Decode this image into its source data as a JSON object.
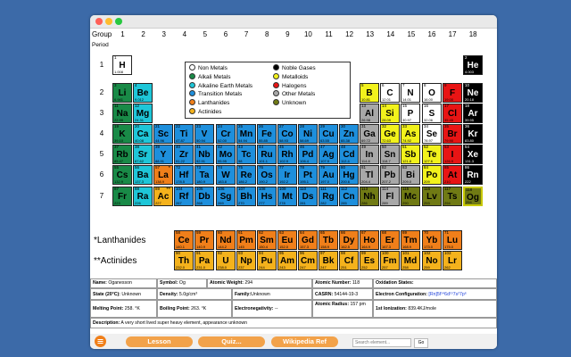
{
  "header": {
    "group_label": "Group",
    "period_label": "Period",
    "groups": [
      "1",
      "2",
      "3",
      "4",
      "5",
      "6",
      "7",
      "8",
      "9",
      "10",
      "11",
      "12",
      "13",
      "14",
      "15",
      "16",
      "17",
      "18"
    ],
    "periods": [
      "1",
      "2",
      "3",
      "4",
      "5",
      "6",
      "7"
    ]
  },
  "legend": [
    {
      "label": "Non Metals",
      "color": "#ffffff"
    },
    {
      "label": "Alkali Metals",
      "color": "#198a47"
    },
    {
      "label": "Alkaline Earth Metals",
      "color": "#1ec6d8"
    },
    {
      "label": "Transition Metals",
      "color": "#1e8fdc"
    },
    {
      "label": "Lanthanides",
      "color": "#f07f1a"
    },
    {
      "label": "Actinides",
      "color": "#f4b21c"
    },
    {
      "label": "Noble Gases",
      "color": "#000000"
    },
    {
      "label": "Metalloids",
      "color": "#f2f21c"
    },
    {
      "label": "Halogens",
      "color": "#e81414"
    },
    {
      "label": "Other Metals",
      "color": "#a8a8a8"
    },
    {
      "label": "Unknown",
      "color": "#707a14"
    }
  ],
  "colors": {
    "N": "#ffffff",
    "A": "#198a47",
    "E": "#1ec6d8",
    "T": "#1e8fdc",
    "L": "#f07f1a",
    "C": "#f4b21c",
    "G": "#000000",
    "M": "#f2f21c",
    "H": "#e81414",
    "O": "#a8a8a8",
    "U": "#707a14"
  },
  "elements": [
    {
      "n": "1",
      "s": "H",
      "w": "1.008",
      "g": 1,
      "p": 1,
      "c": "N"
    },
    {
      "n": "2",
      "s": "He",
      "w": "4.003",
      "g": 18,
      "p": 1,
      "c": "G"
    },
    {
      "n": "3",
      "s": "Li",
      "w": "6.941",
      "g": 1,
      "p": 2,
      "c": "A"
    },
    {
      "n": "4",
      "s": "Be",
      "w": "9.012",
      "g": 2,
      "p": 2,
      "c": "E"
    },
    {
      "n": "5",
      "s": "B",
      "w": "10.81",
      "g": 13,
      "p": 2,
      "c": "M"
    },
    {
      "n": "6",
      "s": "C",
      "w": "12.01",
      "g": 14,
      "p": 2,
      "c": "N"
    },
    {
      "n": "7",
      "s": "N",
      "w": "14.01",
      "g": 15,
      "p": 2,
      "c": "N"
    },
    {
      "n": "8",
      "s": "O",
      "w": "16.00",
      "g": 16,
      "p": 2,
      "c": "N"
    },
    {
      "n": "9",
      "s": "F",
      "w": "19.00",
      "g": 17,
      "p": 2,
      "c": "H"
    },
    {
      "n": "10",
      "s": "Ne",
      "w": "20.18",
      "g": 18,
      "p": 2,
      "c": "G"
    },
    {
      "n": "11",
      "s": "Na",
      "w": "22.99",
      "g": 1,
      "p": 3,
      "c": "A"
    },
    {
      "n": "12",
      "s": "Mg",
      "w": "24.31",
      "g": 2,
      "p": 3,
      "c": "E"
    },
    {
      "n": "13",
      "s": "Al",
      "w": "26.98",
      "g": 13,
      "p": 3,
      "c": "O"
    },
    {
      "n": "14",
      "s": "Si",
      "w": "28.09",
      "g": 14,
      "p": 3,
      "c": "M"
    },
    {
      "n": "15",
      "s": "P",
      "w": "30.97",
      "g": 15,
      "p": 3,
      "c": "N"
    },
    {
      "n": "16",
      "s": "S",
      "w": "32.06",
      "g": 16,
      "p": 3,
      "c": "N"
    },
    {
      "n": "17",
      "s": "Cl",
      "w": "35.45",
      "g": 17,
      "p": 3,
      "c": "H"
    },
    {
      "n": "18",
      "s": "Ar",
      "w": "39.95",
      "g": 18,
      "p": 3,
      "c": "G"
    },
    {
      "n": "19",
      "s": "K",
      "w": "39.10",
      "g": 1,
      "p": 4,
      "c": "A"
    },
    {
      "n": "20",
      "s": "Ca",
      "w": "40.08",
      "g": 2,
      "p": 4,
      "c": "E"
    },
    {
      "n": "21",
      "s": "Sc",
      "w": "44.96",
      "g": 3,
      "p": 4,
      "c": "T"
    },
    {
      "n": "22",
      "s": "Ti",
      "w": "47.87",
      "g": 4,
      "p": 4,
      "c": "T"
    },
    {
      "n": "23",
      "s": "V",
      "w": "50.94",
      "g": 5,
      "p": 4,
      "c": "T"
    },
    {
      "n": "24",
      "s": "Cr",
      "w": "52.00",
      "g": 6,
      "p": 4,
      "c": "T"
    },
    {
      "n": "25",
      "s": "Mn",
      "w": "54.94",
      "g": 7,
      "p": 4,
      "c": "T"
    },
    {
      "n": "26",
      "s": "Fe",
      "w": "55.85",
      "g": 8,
      "p": 4,
      "c": "T"
    },
    {
      "n": "27",
      "s": "Co",
      "w": "58.93",
      "g": 9,
      "p": 4,
      "c": "T"
    },
    {
      "n": "28",
      "s": "Ni",
      "w": "58.69",
      "g": 10,
      "p": 4,
      "c": "T"
    },
    {
      "n": "29",
      "s": "Cu",
      "w": "63.55",
      "g": 11,
      "p": 4,
      "c": "T"
    },
    {
      "n": "30",
      "s": "Zn",
      "w": "65.38",
      "g": 12,
      "p": 4,
      "c": "T"
    },
    {
      "n": "31",
      "s": "Ga",
      "w": "69.72",
      "g": 13,
      "p": 4,
      "c": "O"
    },
    {
      "n": "32",
      "s": "Ge",
      "w": "72.63",
      "g": 14,
      "p": 4,
      "c": "M"
    },
    {
      "n": "33",
      "s": "As",
      "w": "74.92",
      "g": 15,
      "p": 4,
      "c": "M"
    },
    {
      "n": "34",
      "s": "Se",
      "w": "78.97",
      "g": 16,
      "p": 4,
      "c": "N"
    },
    {
      "n": "35",
      "s": "Br",
      "w": "79.90",
      "g": 17,
      "p": 4,
      "c": "H"
    },
    {
      "n": "36",
      "s": "Kr",
      "w": "83.80",
      "g": 18,
      "p": 4,
      "c": "G"
    },
    {
      "n": "37",
      "s": "Rb",
      "w": "85.47",
      "g": 1,
      "p": 5,
      "c": "A"
    },
    {
      "n": "38",
      "s": "Sr",
      "w": "87.62",
      "g": 2,
      "p": 5,
      "c": "E"
    },
    {
      "n": "39",
      "s": "Y",
      "w": "88.91",
      "g": 3,
      "p": 5,
      "c": "T"
    },
    {
      "n": "40",
      "s": "Zr",
      "w": "91.22",
      "g": 4,
      "p": 5,
      "c": "T"
    },
    {
      "n": "41",
      "s": "Nb",
      "w": "92.91",
      "g": 5,
      "p": 5,
      "c": "T"
    },
    {
      "n": "42",
      "s": "Mo",
      "w": "95.95",
      "g": 6,
      "p": 5,
      "c": "T"
    },
    {
      "n": "43",
      "s": "Tc",
      "w": "98",
      "g": 7,
      "p": 5,
      "c": "T"
    },
    {
      "n": "44",
      "s": "Ru",
      "w": "101.1",
      "g": 8,
      "p": 5,
      "c": "T"
    },
    {
      "n": "45",
      "s": "Rh",
      "w": "102.9",
      "g": 9,
      "p": 5,
      "c": "T"
    },
    {
      "n": "46",
      "s": "Pd",
      "w": "106.4",
      "g": 10,
      "p": 5,
      "c": "T"
    },
    {
      "n": "47",
      "s": "Ag",
      "w": "107.9",
      "g": 11,
      "p": 5,
      "c": "T"
    },
    {
      "n": "48",
      "s": "Cd",
      "w": "112.4",
      "g": 12,
      "p": 5,
      "c": "T"
    },
    {
      "n": "49",
      "s": "In",
      "w": "114.8",
      "g": 13,
      "p": 5,
      "c": "O"
    },
    {
      "n": "50",
      "s": "Sn",
      "w": "118.7",
      "g": 14,
      "p": 5,
      "c": "O"
    },
    {
      "n": "51",
      "s": "Sb",
      "w": "121.8",
      "g": 15,
      "p": 5,
      "c": "M"
    },
    {
      "n": "52",
      "s": "Te",
      "w": "127.6",
      "g": 16,
      "p": 5,
      "c": "M"
    },
    {
      "n": "53",
      "s": "I",
      "w": "126.9",
      "g": 17,
      "p": 5,
      "c": "H"
    },
    {
      "n": "54",
      "s": "Xe",
      "w": "131.3",
      "g": 18,
      "p": 5,
      "c": "G"
    },
    {
      "n": "55",
      "s": "Cs",
      "w": "132.9",
      "g": 1,
      "p": 6,
      "c": "A"
    },
    {
      "n": "56",
      "s": "Ba",
      "w": "137.3",
      "g": 2,
      "p": 6,
      "c": "E"
    },
    {
      "n": "57",
      "s": "La",
      "w": "138.9",
      "g": 3,
      "p": 6,
      "c": "L",
      "star": "*"
    },
    {
      "n": "72",
      "s": "Hf",
      "w": "178.5",
      "g": 4,
      "p": 6,
      "c": "T"
    },
    {
      "n": "73",
      "s": "Ta",
      "w": "180.9",
      "g": 5,
      "p": 6,
      "c": "T"
    },
    {
      "n": "74",
      "s": "W",
      "w": "183.8",
      "g": 6,
      "p": 6,
      "c": "T"
    },
    {
      "n": "75",
      "s": "Re",
      "w": "186.2",
      "g": 7,
      "p": 6,
      "c": "T"
    },
    {
      "n": "76",
      "s": "Os",
      "w": "190.2",
      "g": 8,
      "p": 6,
      "c": "T"
    },
    {
      "n": "77",
      "s": "Ir",
      "w": "192.2",
      "g": 9,
      "p": 6,
      "c": "T"
    },
    {
      "n": "78",
      "s": "Pt",
      "w": "195.1",
      "g": 10,
      "p": 6,
      "c": "T"
    },
    {
      "n": "79",
      "s": "Au",
      "w": "197.0",
      "g": 11,
      "p": 6,
      "c": "T"
    },
    {
      "n": "80",
      "s": "Hg",
      "w": "200.6",
      "g": 12,
      "p": 6,
      "c": "T"
    },
    {
      "n": "81",
      "s": "Tl",
      "w": "204.4",
      "g": 13,
      "p": 6,
      "c": "O"
    },
    {
      "n": "82",
      "s": "Pb",
      "w": "207.2",
      "g": 14,
      "p": 6,
      "c": "O"
    },
    {
      "n": "83",
      "s": "Bi",
      "w": "209.0",
      "g": 15,
      "p": 6,
      "c": "O"
    },
    {
      "n": "84",
      "s": "Po",
      "w": "209",
      "g": 16,
      "p": 6,
      "c": "M"
    },
    {
      "n": "85",
      "s": "At",
      "w": "210",
      "g": 17,
      "p": 6,
      "c": "H"
    },
    {
      "n": "86",
      "s": "Rn",
      "w": "222",
      "g": 18,
      "p": 6,
      "c": "G"
    },
    {
      "n": "87",
      "s": "Fr",
      "w": "223",
      "g": 1,
      "p": 7,
      "c": "A"
    },
    {
      "n": "88",
      "s": "Ra",
      "w": "226",
      "g": 2,
      "p": 7,
      "c": "E"
    },
    {
      "n": "89",
      "s": "Ac",
      "w": "227",
      "g": 3,
      "p": 7,
      "c": "C",
      "star": "**"
    },
    {
      "n": "104",
      "s": "Rf",
      "w": "267",
      "g": 4,
      "p": 7,
      "c": "T"
    },
    {
      "n": "105",
      "s": "Db",
      "w": "268",
      "g": 5,
      "p": 7,
      "c": "T"
    },
    {
      "n": "106",
      "s": "Sg",
      "w": "269",
      "g": 6,
      "p": 7,
      "c": "T"
    },
    {
      "n": "107",
      "s": "Bh",
      "w": "270",
      "g": 7,
      "p": 7,
      "c": "T"
    },
    {
      "n": "108",
      "s": "Hs",
      "w": "277",
      "g": 8,
      "p": 7,
      "c": "T"
    },
    {
      "n": "109",
      "s": "Mt",
      "w": "278",
      "g": 9,
      "p": 7,
      "c": "T"
    },
    {
      "n": "110",
      "s": "Ds",
      "w": "281",
      "g": 10,
      "p": 7,
      "c": "T"
    },
    {
      "n": "111",
      "s": "Rg",
      "w": "282",
      "g": 11,
      "p": 7,
      "c": "T"
    },
    {
      "n": "112",
      "s": "Cn",
      "w": "285",
      "g": 12,
      "p": 7,
      "c": "T"
    },
    {
      "n": "113",
      "s": "Nh",
      "w": "286",
      "g": 13,
      "p": 7,
      "c": "U"
    },
    {
      "n": "114",
      "s": "Fl",
      "w": "289",
      "g": 14,
      "p": 7,
      "c": "O"
    },
    {
      "n": "115",
      "s": "Mc",
      "w": "290",
      "g": 15,
      "p": 7,
      "c": "U"
    },
    {
      "n": "116",
      "s": "Lv",
      "w": "293",
      "g": 16,
      "p": 7,
      "c": "U"
    },
    {
      "n": "117",
      "s": "Ts",
      "w": "294",
      "g": 17,
      "p": 7,
      "c": "U"
    },
    {
      "n": "118",
      "s": "Og",
      "w": "294",
      "g": 18,
      "p": 7,
      "c": "U",
      "sel": true
    },
    {
      "n": "58",
      "s": "Ce",
      "w": "140.1",
      "g": 4,
      "p": 9,
      "c": "L"
    },
    {
      "n": "59",
      "s": "Pr",
      "w": "140.9",
      "g": 5,
      "p": 9,
      "c": "L"
    },
    {
      "n": "60",
      "s": "Nd",
      "w": "144.2",
      "g": 6,
      "p": 9,
      "c": "L"
    },
    {
      "n": "61",
      "s": "Pm",
      "w": "145",
      "g": 7,
      "p": 9,
      "c": "L"
    },
    {
      "n": "62",
      "s": "Sm",
      "w": "150.4",
      "g": 8,
      "p": 9,
      "c": "L"
    },
    {
      "n": "63",
      "s": "Eu",
      "w": "152.0",
      "g": 9,
      "p": 9,
      "c": "L"
    },
    {
      "n": "64",
      "s": "Gd",
      "w": "157.3",
      "g": 10,
      "p": 9,
      "c": "L"
    },
    {
      "n": "65",
      "s": "Tb",
      "w": "158.9",
      "g": 11,
      "p": 9,
      "c": "L"
    },
    {
      "n": "66",
      "s": "Dy",
      "w": "162.5",
      "g": 12,
      "p": 9,
      "c": "L"
    },
    {
      "n": "67",
      "s": "Ho",
      "w": "164.9",
      "g": 13,
      "p": 9,
      "c": "L"
    },
    {
      "n": "68",
      "s": "Er",
      "w": "167.3",
      "g": 14,
      "p": 9,
      "c": "L"
    },
    {
      "n": "69",
      "s": "Tm",
      "w": "168.9",
      "g": 15,
      "p": 9,
      "c": "L"
    },
    {
      "n": "70",
      "s": "Yb",
      "w": "173.0",
      "g": 16,
      "p": 9,
      "c": "L"
    },
    {
      "n": "71",
      "s": "Lu",
      "w": "175.0",
      "g": 17,
      "p": 9,
      "c": "L"
    },
    {
      "n": "90",
      "s": "Th",
      "w": "232.0",
      "g": 4,
      "p": 10,
      "c": "C"
    },
    {
      "n": "91",
      "s": "Pa",
      "w": "231.0",
      "g": 5,
      "p": 10,
      "c": "C"
    },
    {
      "n": "92",
      "s": "U",
      "w": "238.0",
      "g": 6,
      "p": 10,
      "c": "C"
    },
    {
      "n": "93",
      "s": "Np",
      "w": "237",
      "g": 7,
      "p": 10,
      "c": "C"
    },
    {
      "n": "94",
      "s": "Pu",
      "w": "244",
      "g": 8,
      "p": 10,
      "c": "C"
    },
    {
      "n": "95",
      "s": "Am",
      "w": "243",
      "g": 9,
      "p": 10,
      "c": "C"
    },
    {
      "n": "96",
      "s": "Cm",
      "w": "247",
      "g": 10,
      "p": 10,
      "c": "C"
    },
    {
      "n": "97",
      "s": "Bk",
      "w": "247",
      "g": 11,
      "p": 10,
      "c": "C"
    },
    {
      "n": "98",
      "s": "Cf",
      "w": "251",
      "g": 12,
      "p": 10,
      "c": "C"
    },
    {
      "n": "99",
      "s": "Es",
      "w": "252",
      "g": 13,
      "p": 10,
      "c": "C"
    },
    {
      "n": "100",
      "s": "Fm",
      "w": "257",
      "g": 14,
      "p": 10,
      "c": "C"
    },
    {
      "n": "101",
      "s": "Md",
      "w": "258",
      "g": 15,
      "p": 10,
      "c": "C"
    },
    {
      "n": "102",
      "s": "No",
      "w": "259",
      "g": 16,
      "p": 10,
      "c": "C"
    },
    {
      "n": "103",
      "s": "Lr",
      "w": "262",
      "g": 17,
      "p": 10,
      "c": "C"
    }
  ],
  "series_labels": {
    "lanthanides": "*Lanthanides",
    "actinides": "**Actinides"
  },
  "info": {
    "name_label": "Name:",
    "name": "Oganesson",
    "symbol_label": "Symbol:",
    "symbol": "Og",
    "weight_label": "Atomic Weight:",
    "weight": "294",
    "number_label": "Atomic Number:",
    "number": "118",
    "oxidation_label": "Oxidation States:",
    "oxidation": "",
    "state_label": "State (20°C):",
    "state": "Unknown",
    "density_label": "Density:",
    "density": "5.0g/cm³",
    "family_label": "Family:",
    "family": "Unknown",
    "casrn_label": "CASRN:",
    "casrn": "54144-19-3",
    "config_label": "Electron Configuration:",
    "config": "[Rn]5f¹⁴6d¹⁰7s²7p⁶",
    "melting_label": "Melting Point:",
    "melting": "258. °K",
    "boiling_label": "Boiling Point:",
    "boiling": "263. °K",
    "electroneg_label": "Electronegativity:",
    "electroneg": "--",
    "radius_label": "Atomic Radius:",
    "radius": "157 pm",
    "ionization_label": "1st Ionization:",
    "ionization": "839.4KJ/mole",
    "description_label": "Description:",
    "description": "A very short lived super heavy element, appearance unknown"
  },
  "buttons": {
    "lesson": "Lesson",
    "quiz": "Quiz...",
    "wikipedia": "Wikipedia Ref"
  },
  "search": {
    "placeholder": "Search element...",
    "go": "Go"
  }
}
